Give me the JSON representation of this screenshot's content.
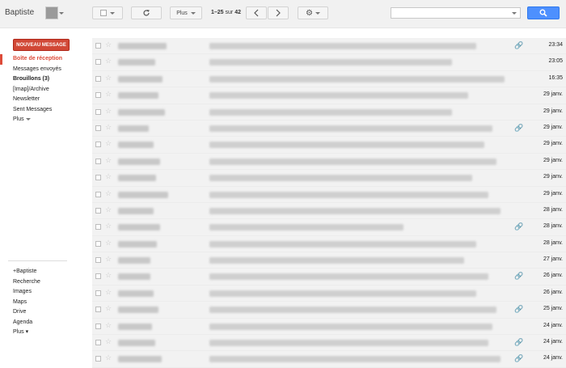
{
  "account": {
    "name": "Baptiste"
  },
  "toolbar": {
    "more_label": "Plus",
    "pager_range": "1–25",
    "pager_of": "sur",
    "pager_total": "42"
  },
  "compose": {
    "label": "NOUVEAU MESSAGE"
  },
  "nav": [
    {
      "label": "Boîte de réception",
      "active": true
    },
    {
      "label": "Messages envoyés"
    },
    {
      "label": "Brouillons (3)",
      "bold": true
    },
    {
      "label": "[Imap]/Archive"
    },
    {
      "label": "Newsletter"
    },
    {
      "label": "Sent Messages"
    },
    {
      "label": "Plus"
    }
  ],
  "apps": [
    {
      "label": "+Baptiste"
    },
    {
      "label": "Recherche"
    },
    {
      "label": "Images"
    },
    {
      "label": "Maps"
    },
    {
      "label": "Drive"
    },
    {
      "label": "Agenda"
    },
    {
      "label": "Plus"
    }
  ],
  "emails": [
    {
      "date": "23:34",
      "attach": true
    },
    {
      "date": "23:05",
      "attach": false
    },
    {
      "date": "16:35",
      "attach": false
    },
    {
      "date": "29 janv.",
      "attach": false
    },
    {
      "date": "29 janv.",
      "attach": false
    },
    {
      "date": "29 janv.",
      "attach": true
    },
    {
      "date": "29 janv.",
      "attach": false
    },
    {
      "date": "29 janv.",
      "attach": false
    },
    {
      "date": "29 janv.",
      "attach": false
    },
    {
      "date": "29 janv.",
      "attach": false
    },
    {
      "date": "28 janv.",
      "attach": false
    },
    {
      "date": "28 janv.",
      "attach": true
    },
    {
      "date": "28 janv.",
      "attach": false
    },
    {
      "date": "27 janv.",
      "attach": false
    },
    {
      "date": "26 janv.",
      "attach": true
    },
    {
      "date": "26 janv.",
      "attach": false
    },
    {
      "date": "25 janv.",
      "attach": true
    },
    {
      "date": "24 janv.",
      "attach": false
    },
    {
      "date": "24 janv.",
      "attach": true
    },
    {
      "date": "24 janv.",
      "attach": true
    }
  ],
  "colors": {
    "accent": "#dd4b39",
    "compose": "#d14836",
    "search_button": "#4d90fe"
  }
}
